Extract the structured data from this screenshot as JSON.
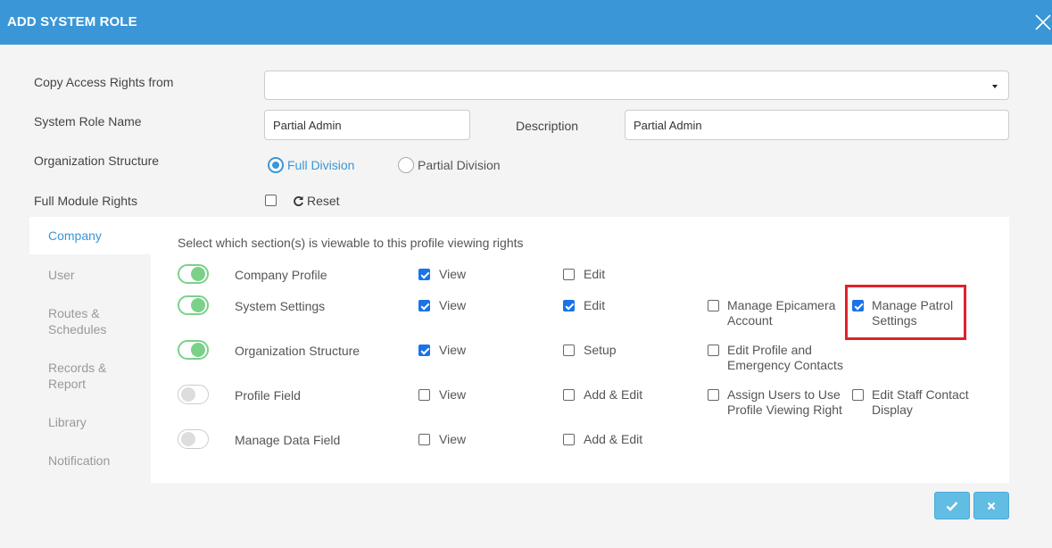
{
  "header": {
    "title": "ADD SYSTEM ROLE"
  },
  "form": {
    "copy_label": "Copy Access Rights from",
    "copy_value": "",
    "role_name_label": "System Role Name",
    "role_name_value": "Partial Admin",
    "description_label": "Description",
    "description_value": "Partial Admin",
    "org_label": "Organization Structure",
    "org_options": {
      "full": "Full Division",
      "partial": "Partial Division"
    },
    "org_selected": "Full Division",
    "full_module_label": "Full Module Rights",
    "full_module_checked": false,
    "reset_label": "Reset"
  },
  "sidebar": {
    "items": [
      "Company",
      "User",
      "Routes &\nSchedules",
      "Records &\nReport",
      "Library",
      "Notification"
    ],
    "active": "Company"
  },
  "panel": {
    "description": "Select which section(s) is viewable to this profile viewing rights",
    "rows": [
      {
        "name": "Company Profile",
        "enabled": true,
        "options": [
          {
            "label": "View",
            "checked": true
          },
          {
            "label": "Edit",
            "checked": false
          }
        ]
      },
      {
        "name": "System Settings",
        "enabled": true,
        "options": [
          {
            "label": "View",
            "checked": true
          },
          {
            "label": "Edit",
            "checked": true
          },
          {
            "label": "Manage Epicamera Account",
            "checked": false
          },
          {
            "label": "Manage Patrol Settings",
            "checked": true
          }
        ]
      },
      {
        "name": "Organization Structure",
        "enabled": true,
        "options": [
          {
            "label": "View",
            "checked": true
          },
          {
            "label": "Setup",
            "checked": false
          },
          {
            "label": "Edit Profile and Emergency Contacts",
            "checked": false
          }
        ]
      },
      {
        "name": "Profile Field",
        "enabled": false,
        "options": [
          {
            "label": "View",
            "checked": false
          },
          {
            "label": "Add & Edit",
            "checked": false
          },
          {
            "label": "Assign Users to Use Profile Viewing Right",
            "checked": false
          },
          {
            "label": "Edit Staff Contact Display",
            "checked": false
          }
        ]
      },
      {
        "name": "Manage Data Field",
        "enabled": false,
        "options": [
          {
            "label": "View",
            "checked": false
          },
          {
            "label": "Add & Edit",
            "checked": false
          }
        ]
      }
    ]
  },
  "colors": {
    "header": "#3a96d6",
    "accent": "#3a96d6",
    "toggle_on": "#7bd18a",
    "highlight": "#e0222a",
    "button": "#62bde5"
  },
  "icons": {
    "close": "close-icon",
    "reset": "refresh-icon",
    "confirm": "check-icon",
    "cancel": "x-icon"
  }
}
